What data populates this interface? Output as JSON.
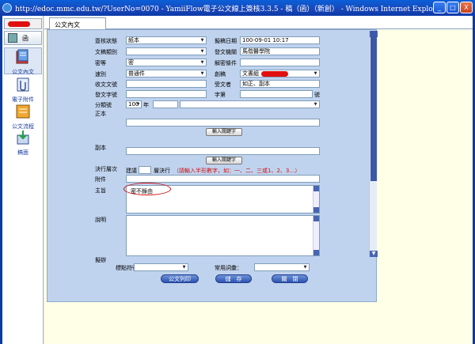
{
  "window": {
    "title": "http://edoc.mmc.edu.tw/?UserNo=0070 - YamiiFlow電子公文線上簽核3.3.5 - 稿（函）（新創） - Windows Internet Explorer",
    "buttons": [
      "_",
      "□",
      "X"
    ]
  },
  "sidebar": {
    "doc_type": "函",
    "nav": [
      {
        "label": "公文內文",
        "icon": "document-edit-icon"
      },
      {
        "label": "電子附件",
        "icon": "attachment-icon"
      },
      {
        "label": "公文流程",
        "icon": "workflow-icon"
      },
      {
        "label": "稿面",
        "icon": "download-icon"
      }
    ]
  },
  "tab": {
    "label": "公文內文"
  },
  "form": {
    "sign_status_label": "簽核狀態",
    "sign_status_value": "紙本",
    "draft_date_label": "擬稿日期",
    "draft_date_value": "100-09-01  10:17",
    "doc_category_label": "文稿類別",
    "doc_category_value": "",
    "issuing_org_label": "發文機關",
    "issuing_org_value": "馬偕醫學院",
    "security_label": "密等",
    "security_value": "密",
    "declass_label": "解密條件",
    "declass_value": "",
    "speed_label": "速別",
    "speed_value": "普通件",
    "draft_label": "創稿",
    "draft_value": "文書組",
    "recv_no_label": "收文文號",
    "recv_no_value": "",
    "recipient_label": "受文者",
    "recipient_value": "如正、副本",
    "send_no_label": "發文字號",
    "send_no_value": "",
    "word_label": "字第",
    "word_value": "",
    "hao_label": "號",
    "class_label": "分類號",
    "class_value": "100",
    "year_label": "年",
    "main_copy_label": "正本",
    "cc_label": "副本",
    "enter_keyword": "輸入關鍵字",
    "exec_label": "決行層次",
    "exec_suggest": "建議",
    "exec_level_text": "層決行",
    "exec_hint": "（請輸入半形數字，如：一、二、三或1、2、3…）",
    "attach_label": "附件",
    "subject_label": "主旨",
    "subject_value": "密不錄由",
    "desc_label": "說明",
    "proposal_label": "擬辦"
  },
  "bottom": {
    "tag_label": "標點符號：",
    "phrase_label": "常用詞彙：",
    "print_btn": "公文列印",
    "save_btn": "儲　存",
    "close_btn": "關　閉"
  }
}
